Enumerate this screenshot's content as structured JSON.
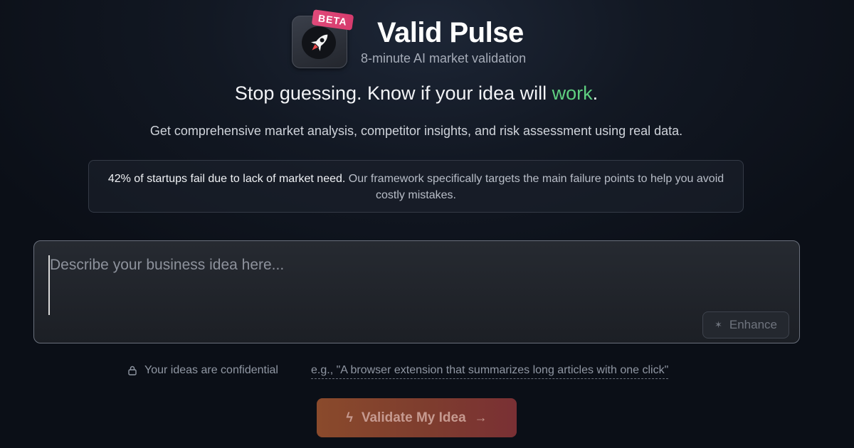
{
  "header": {
    "badge": "BETA",
    "title": "Valid Pulse",
    "subtitle": "8-minute AI market validation",
    "logo_icon": "rocket-icon"
  },
  "hero": {
    "headline_pre": "Stop guessing. Know if your idea will ",
    "headline_accent": "work",
    "headline_post": ".",
    "description": "Get comprehensive market analysis, competitor insights, and risk assessment using real data."
  },
  "stat": {
    "strong": "42% of startups fail due to lack of market need.",
    "rest": " Our framework specifically targets the main failure points to help you avoid costly mistakes."
  },
  "idea": {
    "placeholder": "Describe your business idea here...",
    "value": "",
    "enhance_label": "Enhance"
  },
  "meta": {
    "confidential": "Your ideas are confidential",
    "example": "e.g., \"A browser extension that summarizes long articles with one click\""
  },
  "cta": {
    "label": "Validate My Idea",
    "icon": "lightning-icon",
    "arrow": "arrow-right-icon"
  },
  "colors": {
    "accent": "#5fcf80",
    "badge": "#e04a7a",
    "cta_start": "#8a4a2c",
    "cta_end": "#7a3034"
  }
}
